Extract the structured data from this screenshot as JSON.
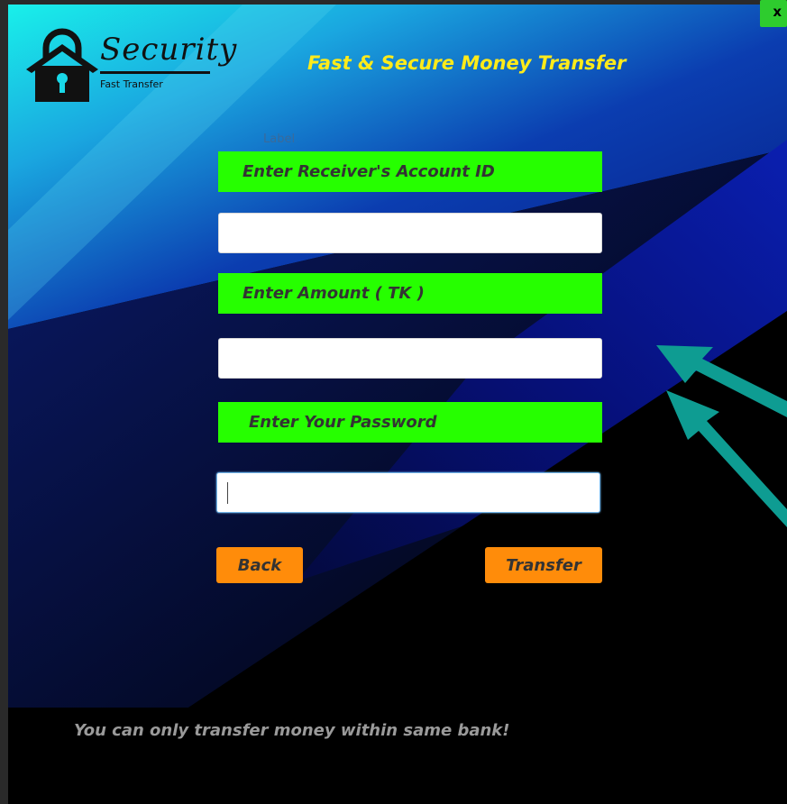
{
  "logo": {
    "word": "Security",
    "subtitle": "Fast Transfer"
  },
  "header": {
    "title": "Fast & Secure Money Transfer"
  },
  "form": {
    "hidden_label": "Label",
    "receiver_label": "Enter Receiver's Account ID",
    "receiver_value": "",
    "amount_label": "Enter Amount ( TK )",
    "amount_value": "",
    "password_label": "Enter Your Password",
    "password_value": ""
  },
  "buttons": {
    "back": "Back",
    "transfer": "Transfer"
  },
  "footer": {
    "note": "You can only transfer money within same bank!"
  },
  "window": {
    "close": "x"
  },
  "colors": {
    "accent_green": "#26ff00",
    "button_orange": "#ff8c0a",
    "title_yellow": "#ffeb1a",
    "arrow_teal": "#0e9c92",
    "gradient_cyan": "#19f0ea",
    "gradient_blue": "#0b3db0",
    "gradient_navy": "#06107a"
  }
}
